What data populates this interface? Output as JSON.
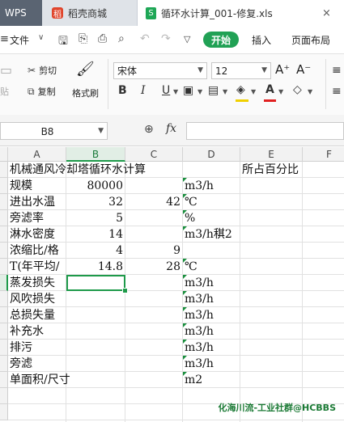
{
  "tabs": {
    "app": "WPS",
    "store": "稻壳商城",
    "file": "循环水计算_001-修复.xls",
    "store_icon": "稻",
    "file_icon": "S",
    "close": "×"
  },
  "menu": {
    "hamburger": "≡",
    "file": "文件",
    "start": "开始",
    "insert": "插入",
    "page_layout": "页面布局"
  },
  "ribbon": {
    "paste": "贴",
    "cut": "剪切",
    "copy": "复制",
    "format_painter": "格式刷",
    "font_name": "宋体",
    "font_size": "12",
    "bold": "B",
    "italic": "I",
    "underline": "U",
    "grow_font": "A⁺",
    "shrink_font": "A⁻",
    "colors": {
      "highlight": "#f0d000",
      "font_color": "#e02020",
      "accent": "#21a155"
    }
  },
  "formula_bar": {
    "name_box": "B8",
    "fx": "fx",
    "formula": ""
  },
  "grid": {
    "columns": [
      "A",
      "B",
      "C",
      "D",
      "E",
      "F"
    ],
    "selected_column": "B",
    "selected_row": 8,
    "rows": [
      {
        "a": "机械通风冷却塔循环水计算",
        "b": "",
        "c": "",
        "d": "",
        "e": "所占百分比"
      },
      {
        "a": "规模",
        "b": "80000",
        "c": "",
        "d": "m3/h",
        "e": ""
      },
      {
        "a": "进出水温",
        "b": "32",
        "c": "42",
        "d": "℃",
        "e": ""
      },
      {
        "a": "旁滤率",
        "b": "5",
        "c": "",
        "d": "%",
        "e": ""
      },
      {
        "a": "淋水密度",
        "b": "14",
        "c": "",
        "d": "m3/h稘2",
        "e": ""
      },
      {
        "a": "浓缩比/格",
        "b": "4",
        "c": "9",
        "d": "",
        "e": ""
      },
      {
        "a": "T(年平均/",
        "b": "14.8",
        "c": "28",
        "d": "℃",
        "e": ""
      },
      {
        "a": "蒸发损失",
        "b": "",
        "c": "",
        "d": "m3/h",
        "e": ""
      },
      {
        "a": "风吹损失",
        "b": "",
        "c": "",
        "d": "m3/h",
        "e": ""
      },
      {
        "a": "总损失量",
        "b": "",
        "c": "",
        "d": "m3/h",
        "e": ""
      },
      {
        "a": "补充水",
        "b": "",
        "c": "",
        "d": "m3/h",
        "e": ""
      },
      {
        "a": "排污",
        "b": "",
        "c": "",
        "d": "m3/h",
        "e": ""
      },
      {
        "a": "旁滤",
        "b": "",
        "c": "",
        "d": "m3/h",
        "e": ""
      },
      {
        "a": "单面积/尺寸",
        "b": "",
        "c": "",
        "d": "m2",
        "e": ""
      },
      {
        "a": "",
        "b": "",
        "c": "",
        "d": "",
        "e": ""
      },
      {
        "a": "",
        "b": "",
        "c": "",
        "d": "",
        "e": ""
      }
    ]
  },
  "watermark": "化海川流-工业社群@HCBBS"
}
